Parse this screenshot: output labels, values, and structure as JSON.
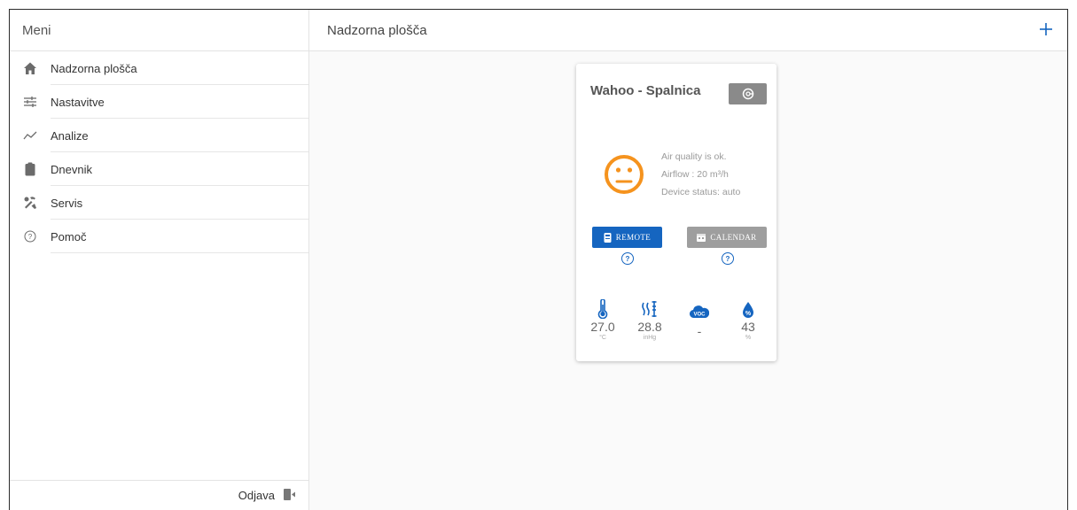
{
  "sidebar": {
    "title": "Meni",
    "items": [
      {
        "label": "Nadzorna plošča",
        "icon": "home-icon"
      },
      {
        "label": "Nastavitve",
        "icon": "sliders-icon"
      },
      {
        "label": "Analize",
        "icon": "trend-line-icon"
      },
      {
        "label": "Dnevnik",
        "icon": "clipboard-icon"
      },
      {
        "label": "Servis",
        "icon": "tools-icon"
      },
      {
        "label": "Pomoč",
        "icon": "help-circle-icon"
      }
    ],
    "logout_label": "Odjava"
  },
  "header": {
    "title": "Nadzorna plošča",
    "add_icon": "plus-icon"
  },
  "device_card": {
    "title": "Wahoo - Spalnica",
    "status_lines": [
      "Air quality is ok.",
      "Airflow :  20 m³/h",
      "Device status:  auto"
    ],
    "remote_label": "REMOTE",
    "calendar_label": "CALENDAR",
    "sensors": [
      {
        "name": "temperature",
        "value": "27.0",
        "unit": "°C",
        "icon": "thermometer-icon"
      },
      {
        "name": "pressure",
        "value": "28.8",
        "unit": "inHg",
        "icon": "pressure-icon"
      },
      {
        "name": "voc",
        "value": "-",
        "unit": "",
        "icon": "voc-cloud-icon"
      },
      {
        "name": "humidity",
        "value": "43",
        "unit": "%",
        "icon": "humidity-drop-icon"
      }
    ]
  },
  "colors": {
    "accent": "#1565c0",
    "smiley": "#f5931e",
    "gray_button": "#9e9e9e"
  }
}
